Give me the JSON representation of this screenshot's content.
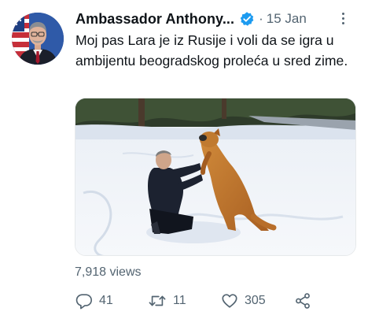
{
  "tweet": {
    "author_name": "Ambassador Anthony...",
    "date_separator": "·",
    "date": "15 Jan",
    "text": "Moj pas Lara je iz Rusije i voli da se igra u ambijentu beogradskog proleća u sred zime.",
    "views": "7,918 views",
    "replies": "41",
    "retweets": "11",
    "likes": "305"
  },
  "colors": {
    "verified": "#1d9bf0",
    "secondary_text": "#536471",
    "primary_text": "#0f1419"
  },
  "icons": {
    "verified": "verified-badge-icon",
    "more": "more-options-icon",
    "reply": "reply-icon",
    "retweet": "retweet-icon",
    "like": "heart-icon",
    "share": "share-icon"
  }
}
